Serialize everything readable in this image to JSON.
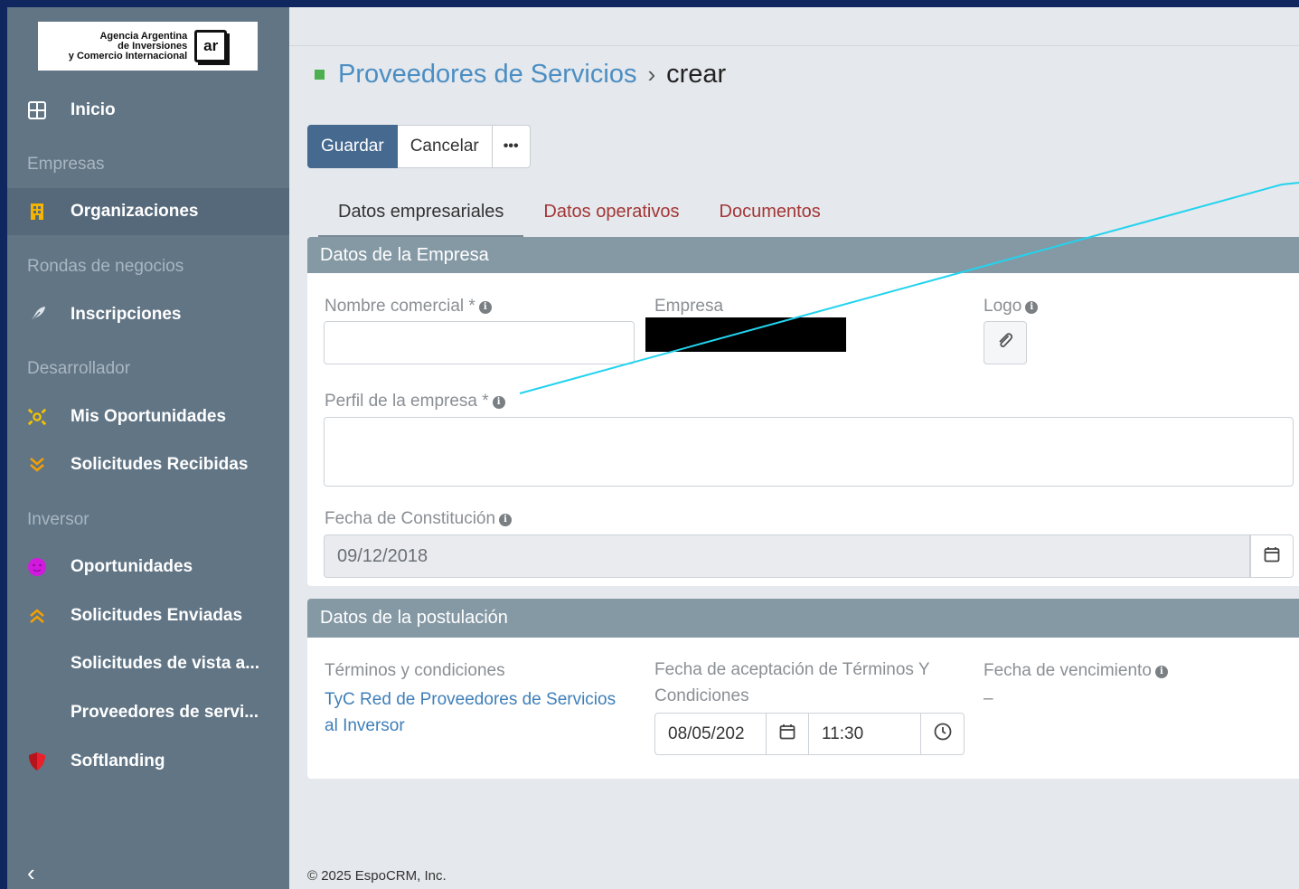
{
  "sidebar": {
    "logo": {
      "line1": "Agencia Argentina",
      "line2": "de Inversiones",
      "line3": "y Comercio Internacional",
      "mark": "ar"
    },
    "items": {
      "inicio": {
        "label": "Inicio",
        "icon": "grid-icon"
      },
      "group_empresas": "Empresas",
      "organizaciones": {
        "label": "Organizaciones",
        "icon": "building-icon"
      },
      "group_rondas": "Rondas de negocios",
      "inscripciones": {
        "label": "Inscripciones",
        "icon": "feather-icon"
      },
      "group_desarrollador": "Desarrollador",
      "mis_oportunidades": {
        "label": "Mis Oportunidades",
        "icon": "sparkle-icon"
      },
      "solicitudes_recibidas": {
        "label": "Solicitudes Recibidas",
        "icon": "double-chevron-down-icon"
      },
      "group_inversor": "Inversor",
      "oportunidades": {
        "label": "Oportunidades",
        "icon": "smiley-icon"
      },
      "solicitudes_enviadas": {
        "label": "Solicitudes Enviadas",
        "icon": "double-chevron-up-icon"
      },
      "solicitudes_vista": {
        "label": "Solicitudes de vista a..."
      },
      "proveedores": {
        "label": "Proveedores de servi..."
      },
      "softlanding": {
        "label": "Softlanding",
        "icon": "shield-icon"
      }
    },
    "collapse": "‹"
  },
  "header": {
    "breadcrumb": "Proveedores de Servicios",
    "separator": "›",
    "current": "crear"
  },
  "toolbar": {
    "save": "Guardar",
    "cancel": "Cancelar",
    "more": "•••"
  },
  "tabs": {
    "t1": "Datos empresariales",
    "t2": "Datos operativos",
    "t3": "Documentos"
  },
  "panel1": {
    "title": "Datos de la Empresa",
    "nombre_label": "Nombre comercial *",
    "nombre_value": "",
    "empresa_label": "Empresa",
    "logo_label": "Logo",
    "perfil_label": "Perfil de la empresa *",
    "perfil_value": "",
    "fecha_label": "Fecha de Constitución",
    "fecha_value": "09/12/2018"
  },
  "panel2": {
    "title": "Datos de la postulación",
    "terminos_label": "Términos y condiciones",
    "terminos_link_1": "TyC Red de Proveedores de Servicios",
    "terminos_link_2": "al Inversor",
    "aceptacion_label_1": "Fecha de aceptación de Términos Y",
    "aceptacion_label_2": "Condiciones",
    "aceptacion_date": "08/05/202",
    "aceptacion_time": "11:30",
    "vencimiento_label": "Fecha de vencimiento",
    "vencimiento_value": "–"
  },
  "footer": "© 2025 EspoCRM, Inc.",
  "colors": {
    "accent": "#45698f",
    "sidebar": "#617585",
    "panel_header": "#8599a5",
    "annotation": "#22d3ee",
    "tab_link": "#a33636"
  }
}
